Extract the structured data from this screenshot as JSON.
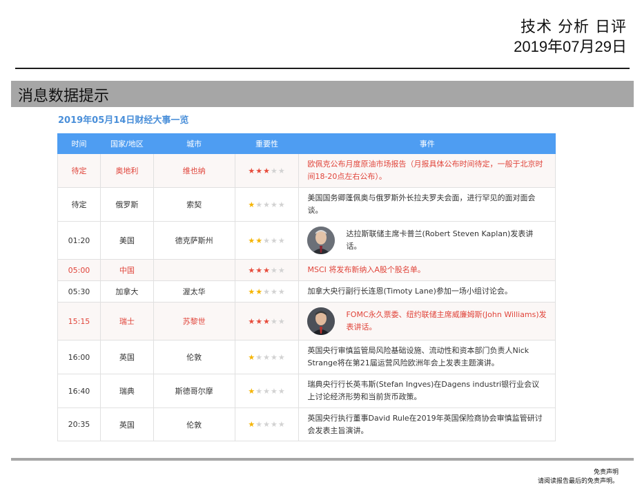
{
  "header": {
    "title": "技术 分析 日评",
    "date": "2019年07月29日"
  },
  "section": {
    "title": "消息数据提示"
  },
  "table": {
    "subtitle": "2019年05月14日财经大事一览",
    "columns": [
      "时间",
      "国家/地区",
      "城市",
      "重要性",
      "事件"
    ],
    "rows": [
      {
        "time": "待定",
        "country": "奥地利",
        "city": "维也纳",
        "stars": 3,
        "event": "欧佩克公布月度原油市场报告（月报具体公布时间待定，一般于北京时间18-20点左右公布）。"
      },
      {
        "time": "待定",
        "country": "俄罗斯",
        "city": "索契",
        "stars": 1,
        "event": "美国国务卿蓬佩奥与俄罗斯外长拉夫罗夫会面，进行罕见的面对面会谈。"
      },
      {
        "time": "01:20",
        "country": "美国",
        "city": "德克萨斯州",
        "stars": 2,
        "event": "达拉斯联储主席卡普兰(Robert Steven Kaplan)发表讲话。"
      },
      {
        "time": "05:00",
        "country": "中国",
        "city": "",
        "stars": 3,
        "event": "MSCI 将发布新纳入A股个股名单。"
      },
      {
        "time": "05:30",
        "country": "加拿大",
        "city": "渥太华",
        "stars": 2,
        "event": "加拿大央行副行长连恩(Timoty Lane)参加一场小组讨论会。"
      },
      {
        "time": "15:15",
        "country": "瑞士",
        "city": "苏黎世",
        "stars": 3,
        "event": "FOMC永久票委、纽约联储主席威廉姆斯(John Williams)发表讲话。"
      },
      {
        "time": "16:00",
        "country": "英国",
        "city": "伦敦",
        "stars": 1,
        "event": "英国央行审慎监管局风险基础设施、流动性和资本部门负责人Nick Strange将在第21届运营风险欧洲年会上发表主题演讲。"
      },
      {
        "time": "16:40",
        "country": "瑞典",
        "city": "斯德哥尔摩",
        "stars": 1,
        "event": "瑞典央行行长英韦斯(Stefan Ingves)在Dagens industri银行业会议上讨论经济形势和当前货币政策。"
      },
      {
        "time": "20:35",
        "country": "英国",
        "city": "伦敦",
        "stars": 1,
        "event": "英国央行执行董事David Rule在2019年英国保险商协会审慎监管研讨会发表主旨演讲。"
      }
    ]
  },
  "footer": {
    "line1": "免责声明",
    "line2": "请阅读报告最后的免责声明。"
  }
}
